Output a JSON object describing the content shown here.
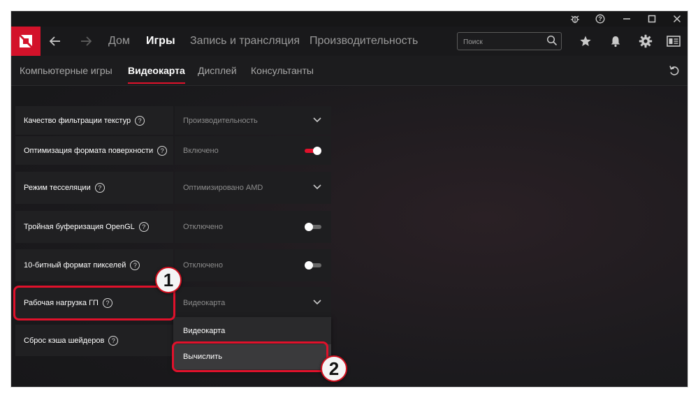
{
  "titlebar": {
    "icons": [
      "bug-icon",
      "help-icon",
      "minimize-icon",
      "maximize-icon",
      "close-icon"
    ]
  },
  "nav": {
    "tabs": [
      {
        "label": "Дом",
        "active": false
      },
      {
        "label": "Игры",
        "active": true
      },
      {
        "label": "Запись и трансляция",
        "active": false
      },
      {
        "label": "Производительность",
        "active": false
      }
    ],
    "search_placeholder": "Поиск",
    "accent": "#d3122a"
  },
  "subnav": {
    "tabs": [
      {
        "label": "Компьютерные игры",
        "active": false
      },
      {
        "label": "Видеокарта",
        "active": true
      },
      {
        "label": "Дисплей",
        "active": false
      },
      {
        "label": "Консультанты",
        "active": false
      }
    ]
  },
  "settings": [
    {
      "label": "Качество фильтрации текстур",
      "value": "Производительность",
      "control": "dropdown"
    },
    {
      "label": "Оптимизация формата поверхности",
      "value": "Включено",
      "control": "toggle",
      "on": true
    },
    {
      "label": "Режим тесселяции",
      "value": "Оптимизировано AMD",
      "control": "dropdown"
    },
    {
      "label": "Тройная буферизация OpenGL",
      "value": "Отключено",
      "control": "toggle",
      "on": false
    },
    {
      "label": "10-битный формат пикселей",
      "value": "Отключено",
      "control": "toggle",
      "on": false
    },
    {
      "label": "Рабочая нагрузка ГП",
      "value": "Видеокарта",
      "control": "dropdown"
    },
    {
      "label": "Сброс кэша шейдеров",
      "value": "",
      "control": "none"
    }
  ],
  "dropdown_options": [
    "Видеокарта",
    "Вычислить"
  ],
  "callouts": {
    "one": "1",
    "two": "2"
  },
  "help_glyph": "?",
  "colors": {
    "toggle_on": "#e0112b",
    "toggle_off": "#6a6a6a",
    "highlight": "#e0112b"
  }
}
